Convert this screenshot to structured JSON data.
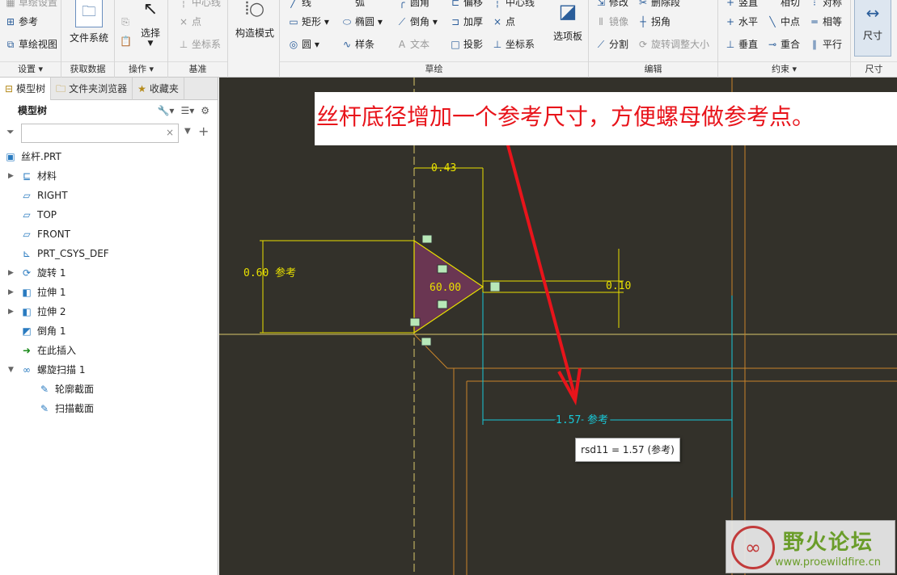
{
  "ribbon": {
    "groups": [
      {
        "label": "设置 ▾",
        "items": [
          "草绘设置",
          "参考",
          "草绘视图"
        ]
      },
      {
        "label": "获取数据",
        "items": [
          "文件系统"
        ]
      },
      {
        "label": "操作 ▾",
        "items": [
          "选择"
        ]
      },
      {
        "label": "基准",
        "items": [
          "中心线",
          "点",
          "坐标系"
        ]
      },
      {
        "label": "",
        "items": [
          "构造模式"
        ]
      },
      {
        "label": "草绘",
        "items": [
          "线",
          "矩形 ▾",
          "圆 ▾",
          "弧",
          "椭圆 ▾",
          "样条",
          "圆角",
          "倒角 ▾",
          "文本",
          "偏移",
          "加厚",
          "投影",
          "中心线",
          "点",
          "坐标系",
          "选项板"
        ]
      },
      {
        "label": "编辑",
        "items": [
          "修改",
          "删除段",
          "镜像",
          "拐角",
          "分割",
          "旋转调整大小"
        ]
      },
      {
        "label": "约束 ▾",
        "items": [
          "竖直",
          "相切",
          "对称",
          "水平",
          "中点",
          "相等",
          "垂直",
          "重合",
          "平行"
        ]
      },
      {
        "label": "尺寸",
        "items": [
          "尺寸"
        ]
      }
    ]
  },
  "left_panel": {
    "tabs": [
      "模型树",
      "文件夹浏览器",
      "收藏夹"
    ],
    "header": "模型树",
    "filter_placeholder": "",
    "tree": [
      {
        "label": "丝杆.PRT",
        "level": 0,
        "expand": false,
        "icon": "part-icon"
      },
      {
        "label": "材料",
        "level": 1,
        "expand": true,
        "icon": "material-icon"
      },
      {
        "label": "RIGHT",
        "level": 1,
        "expand": false,
        "icon": "datum-plane-icon"
      },
      {
        "label": "TOP",
        "level": 1,
        "expand": false,
        "icon": "datum-plane-icon"
      },
      {
        "label": "FRONT",
        "level": 1,
        "expand": false,
        "icon": "datum-plane-icon"
      },
      {
        "label": "PRT_CSYS_DEF",
        "level": 1,
        "expand": false,
        "icon": "csys-icon"
      },
      {
        "label": "旋转 1",
        "level": 1,
        "expand": true,
        "icon": "revolve-icon"
      },
      {
        "label": "拉伸 1",
        "level": 1,
        "expand": true,
        "icon": "extrude-icon"
      },
      {
        "label": "拉伸 2",
        "level": 1,
        "expand": true,
        "icon": "extrude-icon"
      },
      {
        "label": "倒角 1",
        "level": 1,
        "expand": false,
        "icon": "chamfer-icon"
      },
      {
        "label": "在此插入",
        "level": 1,
        "expand": false,
        "icon": "insert-arrow-icon"
      },
      {
        "label": "螺旋扫描 1",
        "level": 1,
        "expand": "open",
        "icon": "helical-sweep-icon"
      },
      {
        "label": "轮廓截面",
        "level": 2,
        "expand": false,
        "icon": "sketch-icon"
      },
      {
        "label": "扫描截面",
        "level": 2,
        "expand": false,
        "icon": "sketch-icon"
      }
    ]
  },
  "canvas": {
    "annotation": "丝杆底径增加一个参考尺寸，方便螺母做参考点。",
    "dims": {
      "d043": "0.43",
      "d060": "0.60 参考",
      "d6000": "60.00",
      "d010": "0.10",
      "d157": "1.57 参考"
    },
    "tooltip": "rsd11 = 1.57 (参考)",
    "watermark": {
      "title": "野火论坛",
      "url": "www.proewildfire.cn"
    }
  },
  "colors": {
    "canvas_bg": "#33312a",
    "dim_yellow": "#e8e000",
    "ref_cyan": "#18c8d8",
    "edge_orange": "#c8842a",
    "arrow_red": "#e8141b",
    "profile_fill": "#6a3652"
  }
}
